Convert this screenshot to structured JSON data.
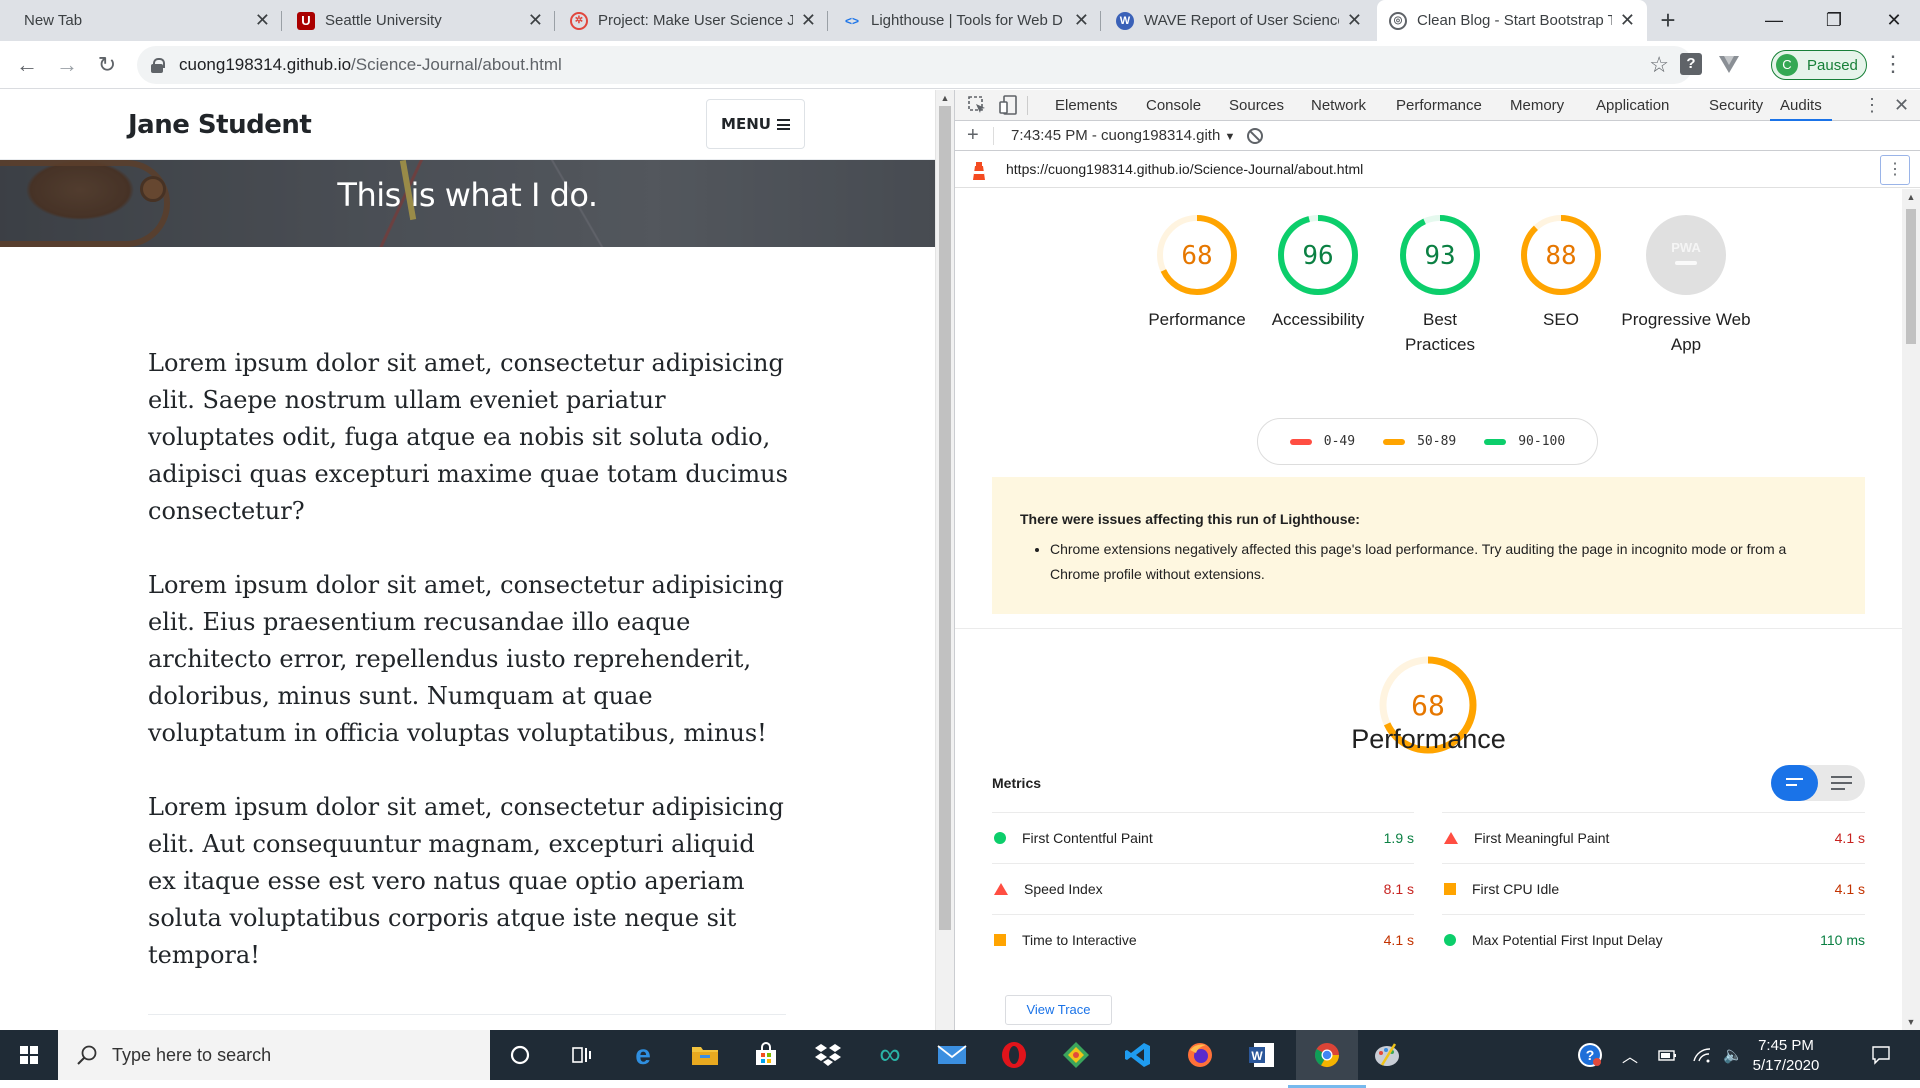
{
  "browser": {
    "tabs": [
      {
        "title": "New Tab",
        "favicon": "none"
      },
      {
        "title": "Seattle University",
        "favicon": "seattle-u-icon"
      },
      {
        "title": "Project: Make User Science Jo",
        "favicon": "udacity-icon"
      },
      {
        "title": "Lighthouse  |  Tools for Web D",
        "favicon": "google-dev-icon"
      },
      {
        "title": "WAVE Report of User Science",
        "favicon": "wave-icon"
      },
      {
        "title": "Clean Blog - Start Bootstrap T",
        "favicon": "globe-icon"
      }
    ],
    "url_host": "cuong198314.github.io",
    "url_path": "/Science-Journal/about.html",
    "profile_initial": "C",
    "profile_status": "Paused"
  },
  "blog": {
    "brand": "Jane Student",
    "menu_label": "MENU",
    "hero_heading": "This is what I do.",
    "paragraphs": [
      "Lorem ipsum dolor sit amet, consectetur adipisicing elit. Saepe nostrum ullam eveniet pariatur voluptates odit, fuga atque ea nobis sit soluta odio, adipisci quas excepturi maxime quae totam ducimus consectetur?",
      "Lorem ipsum dolor sit amet, consectetur adipisicing elit. Eius praesentium recusandae illo eaque architecto error, repellendus iusto reprehenderit, doloribus, minus sunt. Numquam at quae voluptatum in officia voluptas voluptatibus, minus!",
      "Lorem ipsum dolor sit amet, consectetur adipisicing elit. Aut consequuntur magnam, excepturi aliquid ex itaque esse est vero natus quae optio aperiam soluta voluptatibus corporis atque iste neque sit tempora!"
    ]
  },
  "devtools": {
    "tabs": [
      "Elements",
      "Console",
      "Sources",
      "Network",
      "Performance",
      "Memory",
      "Application",
      "Security",
      "Audits"
    ],
    "active_tab": "Audits",
    "run_label": "7:43:45 PM - cuong198314.gith",
    "audit_url": "https://cuong198314.github.io/Science-Journal/about.html",
    "scores": [
      {
        "value": 68,
        "label": "Performance",
        "rating": "avg"
      },
      {
        "value": 96,
        "label": "Accessibility",
        "rating": "good"
      },
      {
        "value": 93,
        "label": "Best Practices",
        "rating": "good"
      },
      {
        "value": 88,
        "label": "SEO",
        "rating": "avg"
      }
    ],
    "pwa": {
      "badge": "PWA",
      "label": "Progressive Web App"
    },
    "legend": [
      {
        "range": "0-49",
        "color": "#ff4e42"
      },
      {
        "range": "50-89",
        "color": "#ffa400"
      },
      {
        "range": "90-100",
        "color": "#0cce6b"
      }
    ],
    "warning_title": "There were issues affecting this run of Lighthouse:",
    "warning_item": "Chrome extensions negatively affected this page's load performance. Try auditing the page in incognito mode or from a Chrome profile without extensions.",
    "perf_score": 68,
    "perf_title": "Performance",
    "metrics_heading": "Metrics",
    "metrics": [
      {
        "name": "First Contentful Paint",
        "value": "1.9 s",
        "rating": "good"
      },
      {
        "name": "First Meaningful Paint",
        "value": "4.1 s",
        "rating": "bad"
      },
      {
        "name": "Speed Index",
        "value": "8.1 s",
        "rating": "bad"
      },
      {
        "name": "First CPU Idle",
        "value": "4.1 s",
        "rating": "avg"
      },
      {
        "name": "Time to Interactive",
        "value": "4.1 s",
        "rating": "avg"
      },
      {
        "name": "Max Potential First Input Delay",
        "value": "110 ms",
        "rating": "good"
      }
    ],
    "view_trace": "View Trace"
  },
  "taskbar": {
    "search_placeholder": "Type here to search",
    "time": "7:45 PM",
    "date": "5/17/2020"
  },
  "colors": {
    "good": "#0cce6b",
    "average": "#ffa400",
    "fail": "#ff4e42",
    "accent": "#1a73e8"
  }
}
